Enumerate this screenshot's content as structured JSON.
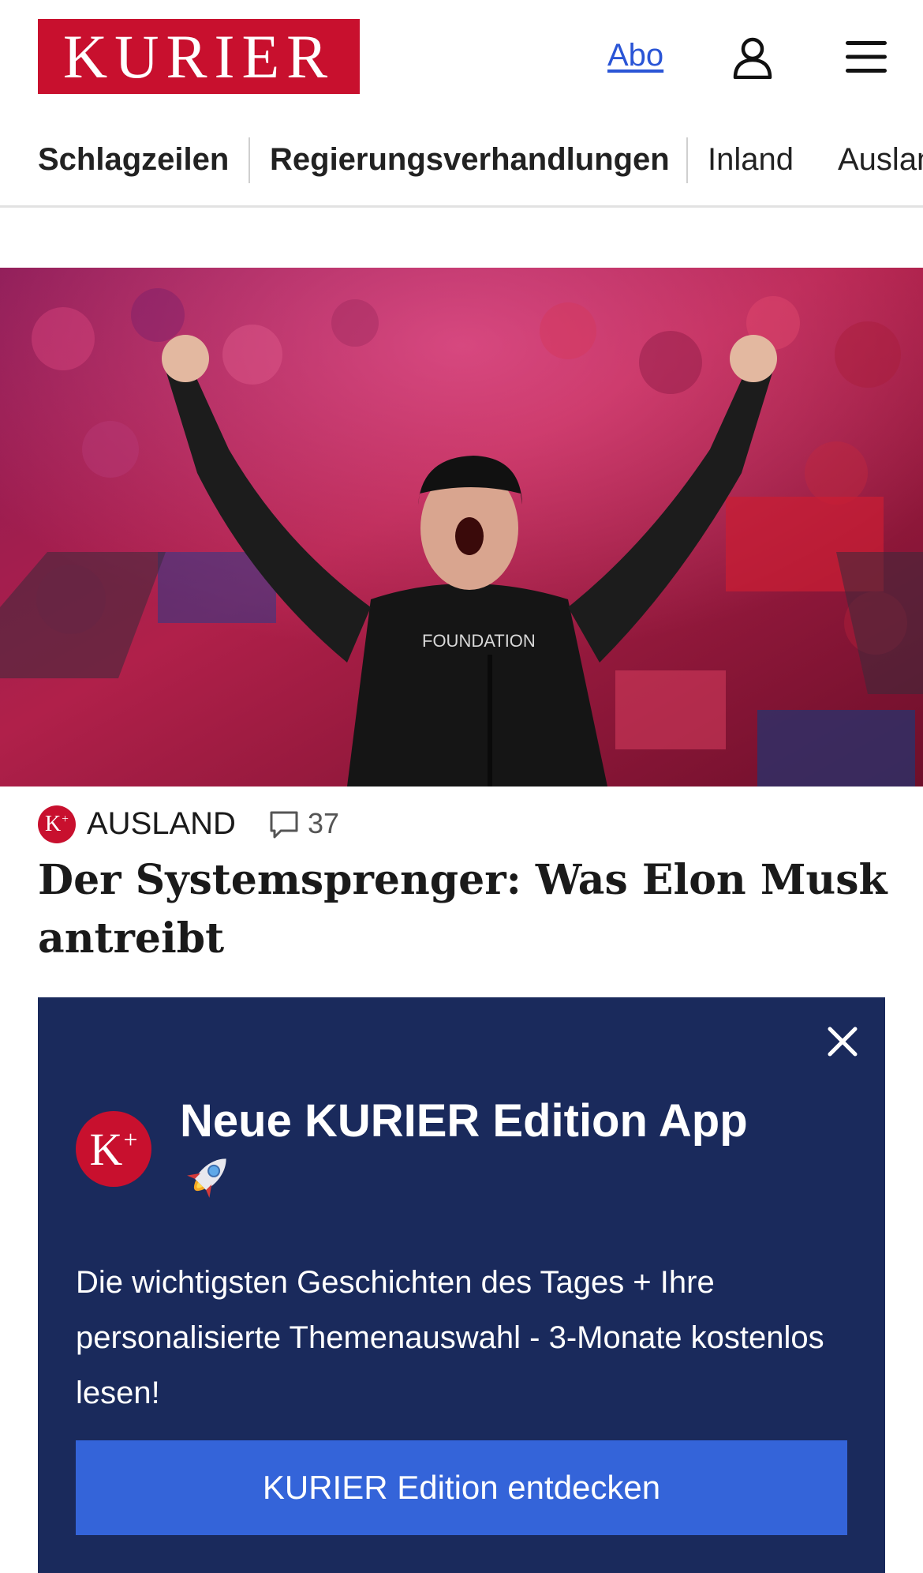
{
  "header": {
    "logo": "KURIER",
    "abo_link": "Abo",
    "icons": {
      "user": "user-icon",
      "menu": "hamburger-menu-icon"
    }
  },
  "nav": {
    "items": [
      {
        "label": "Schlagzeilen",
        "bold": true
      },
      {
        "label": "Regierungsverhandlungen",
        "bold": true
      },
      {
        "label": "Inland",
        "bold": false
      },
      {
        "label": "Ausland",
        "bold": false
      }
    ]
  },
  "article": {
    "image_alt": "Elon Musk jubelt mit erhobenen Fäusten auf einer Bühne",
    "badge": "K+",
    "section": "AUSLAND",
    "comment_count": "37",
    "headline": "Der Systemsprenger: Was Elon Musk antreibt"
  },
  "modal": {
    "badge": "K+",
    "title": "Neue KURIER Edition App",
    "emoji": "🚀",
    "text": "Die wichtigsten Geschichten des Tages + Ihre personalisierte Themenauswahl - 3-Monate kostenlos lesen!",
    "cta_label": "KURIER Edition entdecken"
  },
  "colors": {
    "brand_red": "#c8102e",
    "link_blue": "#2a55d6",
    "modal_bg": "#1a2a5c",
    "cta_blue": "#3464d9"
  }
}
